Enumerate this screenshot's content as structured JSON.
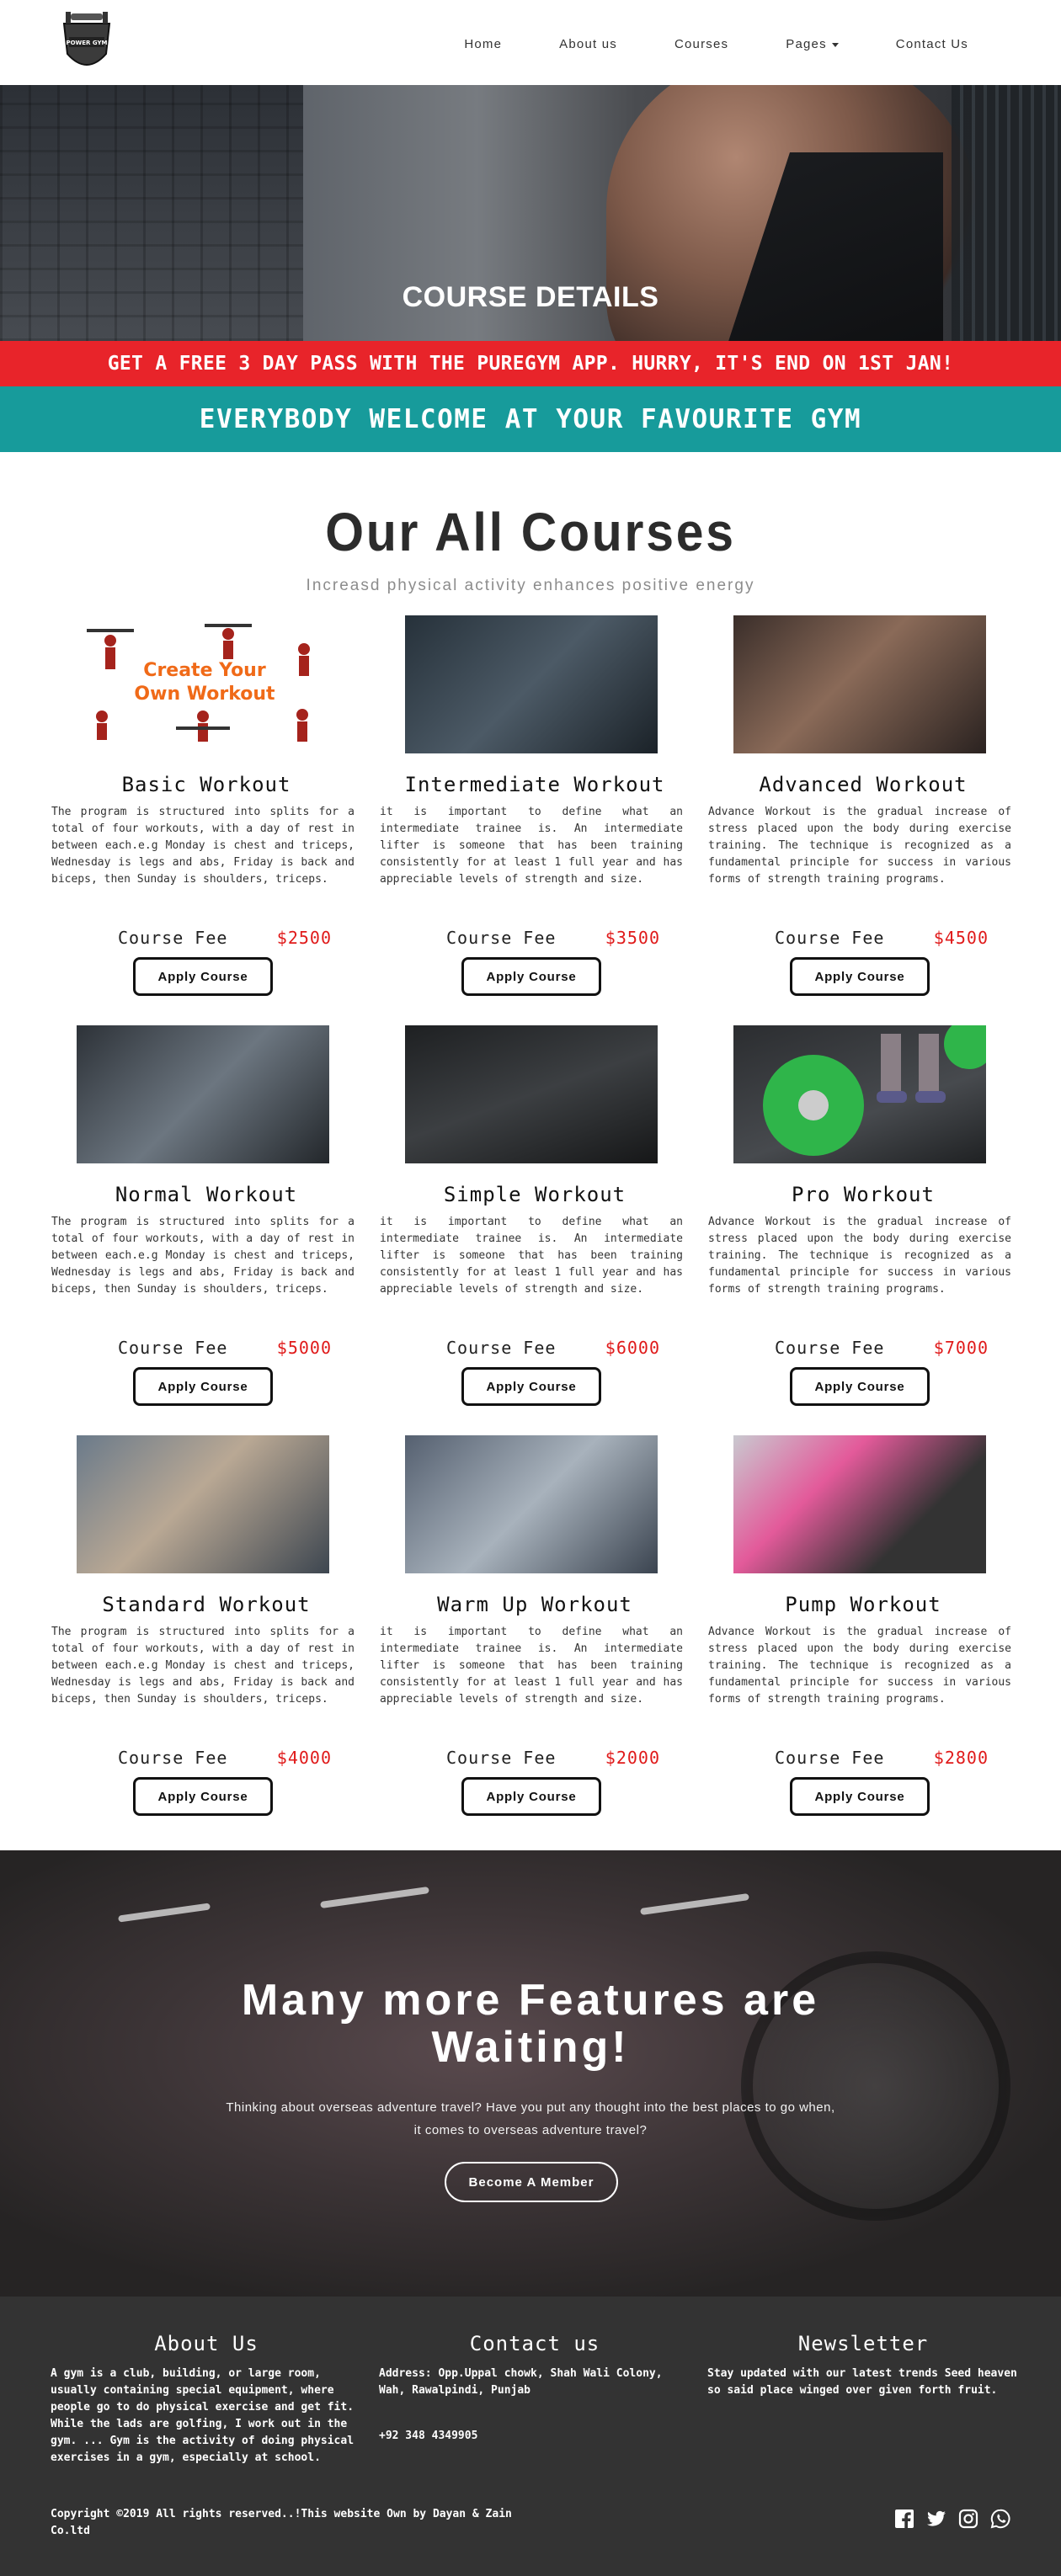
{
  "logo": {
    "alt_icon": "power-gym-logo-icon",
    "text": "POWER GYM"
  },
  "nav": {
    "items": [
      "Home",
      "About us",
      "Courses",
      "Pages",
      "Contact Us"
    ]
  },
  "hero": {
    "title": "COURSE DETAILS"
  },
  "promo": "GET A FREE 3 DAY PASS WITH THE PUREGYM APP. HURRY, IT'S END ON 1ST JAN!",
  "welcome": "EVERYBODY WELCOME AT YOUR FAVOURITE GYM",
  "courses": {
    "title": "Our All Courses",
    "subtitle": "Increasd physical activity enhances positive energy",
    "fee_label": "Course Fee",
    "button_label": "Apply Course",
    "items": [
      {
        "name": "Basic Workout",
        "fee": "$2500",
        "image_text": "Create Your Own Workout",
        "desc": "The program is structured into splits for a total of four workouts, with a day of rest in between each.e.g Monday is chest and triceps, Wednesday is legs and abs, Friday is back and biceps, then Sunday is shoulders, triceps."
      },
      {
        "name": "Intermediate Workout",
        "fee": "$3500",
        "desc": "it is important to define what an intermediate trainee is. An intermediate lifter is someone that has been training consistently for at least 1 full year and has appreciable levels of strength and size."
      },
      {
        "name": "Advanced Workout",
        "fee": "$4500",
        "desc": "Advance Workout is the gradual increase of stress placed upon the body during exercise training. The technique is recognized as a fundamental principle for success in various forms of strength training programs."
      },
      {
        "name": "Normal Workout",
        "fee": "$5000",
        "desc": "The program is structured into splits for a total of four workouts, with a day of rest in between each.e.g Monday is chest and triceps, Wednesday is legs and abs, Friday is back and biceps, then Sunday is shoulders, triceps."
      },
      {
        "name": "Simple Workout",
        "fee": "$6000",
        "desc": "it is important to define what an intermediate trainee is. An intermediate lifter is someone that has been training consistently for at least 1 full year and has appreciable levels of strength and size."
      },
      {
        "name": "Pro Workout",
        "fee": "$7000",
        "desc": "Advance Workout is the gradual increase of stress placed upon the body during exercise training. The technique is recognized as a fundamental principle for success in various forms of strength training programs."
      },
      {
        "name": "Standard Workout",
        "fee": "$4000",
        "desc": "The program is structured into splits for a total of four workouts, with a day of rest in between each.e.g Monday is chest and triceps, Wednesday is legs and abs, Friday is back and biceps, then Sunday is shoulders, triceps."
      },
      {
        "name": "Warm Up Workout",
        "fee": "$2000",
        "desc": "it is important to define what an intermediate trainee is. An intermediate lifter is someone that has been training consistently for at least 1 full year and has appreciable levels of strength and size."
      },
      {
        "name": "Pump Workout",
        "fee": "$2800",
        "desc": "Advance Workout is the gradual increase of stress placed upon the body during exercise training. The technique is recognized as a fundamental principle for success in various forms of strength training programs."
      }
    ]
  },
  "features": {
    "title_line1": "Many more Features are",
    "title_line2": "Waiting!",
    "text_line1": "Thinking about overseas adventure travel? Have you put any thought into the best places to go when,",
    "text_line2": "it comes to overseas adventure travel?",
    "button_label": "Become A Member"
  },
  "footer": {
    "about": {
      "title": "About Us",
      "text": "A gym is a club, building, or large room, usually containing special equipment, where people go to do physical exercise and get fit. While the lads are golfing, I work out in the gym. ... Gym is the activity of doing physical exercises in a gym, especially at school."
    },
    "contact": {
      "title": "Contact us",
      "address": "Address: Opp.Uppal chowk, Shah Wali Colony, Wah, Rawalpindi, Punjab",
      "phone": "+92 348 4349905"
    },
    "newsletter": {
      "title": "Newsletter",
      "text": "Stay updated with our latest trends Seed heaven so said place winged over given forth fruit."
    },
    "copyright": "Copyright ©2019 All rights reserved..!This website Own by Dayan & Zain Co.ltd",
    "social_icons": [
      "facebook-icon",
      "twitter-icon",
      "instagram-icon",
      "whatsapp-icon"
    ]
  },
  "colors": {
    "promo_red": "#e8242a",
    "teal": "#179b9b",
    "fee_red": "#e01a1a",
    "footer_bg": "#333333"
  }
}
